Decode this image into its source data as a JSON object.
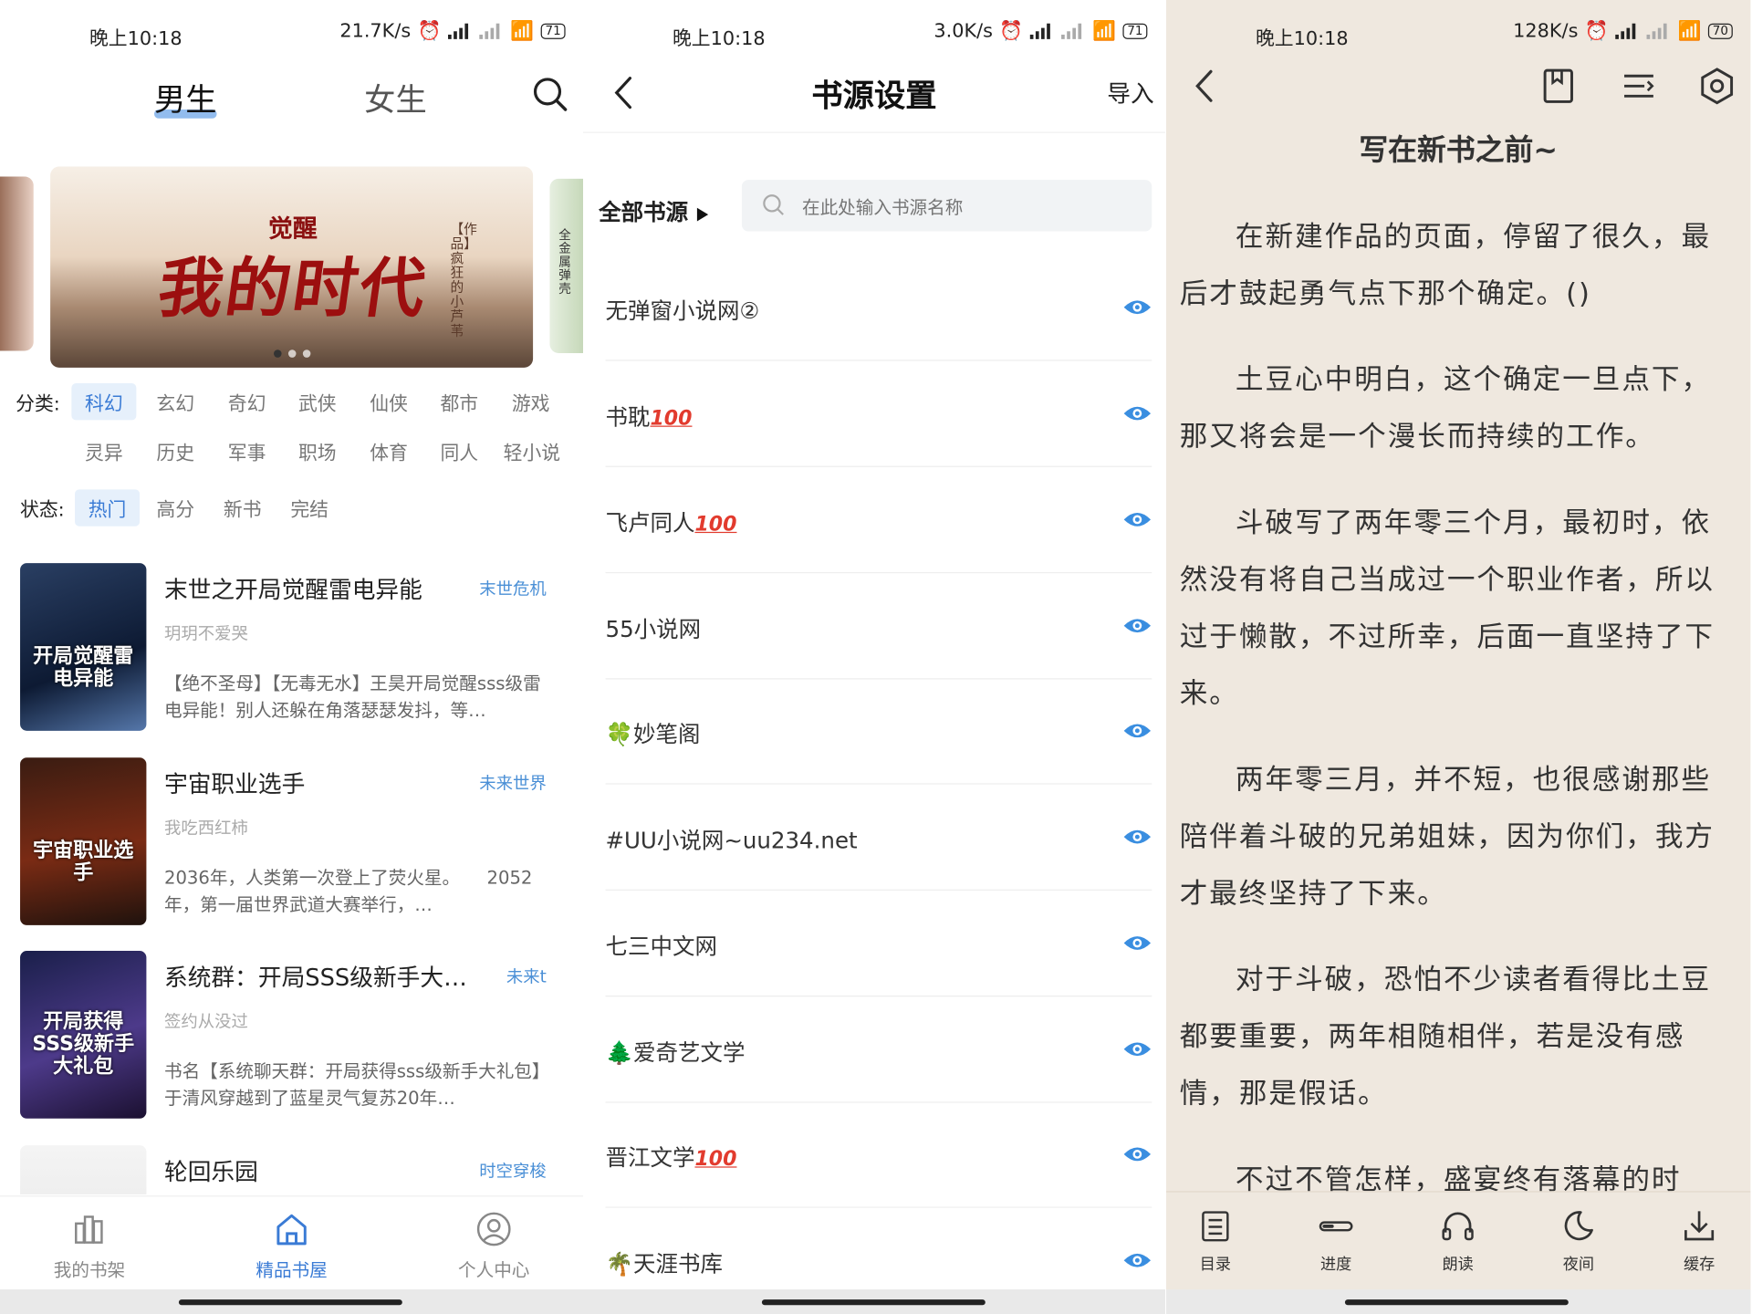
{
  "status_bars": [
    {
      "time": "晚上10:18",
      "speed": "21.7K/s",
      "battery": "71"
    },
    {
      "time": "晚上10:18",
      "speed": "3.0K/s",
      "battery": "71"
    },
    {
      "time": "晚上10:18",
      "speed": "128K/s",
      "battery": "70"
    }
  ],
  "store": {
    "tab_male": "男生",
    "tab_female": "女生",
    "banner": {
      "top_line": "觉醒",
      "main_title": "我的时代",
      "side_text": "【作品】疯狂的小芦苇",
      "right_peek": "全金属弹壳"
    },
    "category_label": "分类:",
    "categories_row1": [
      "科幻",
      "玄幻",
      "奇幻",
      "武侠",
      "仙侠",
      "都市",
      "游戏"
    ],
    "categories_row2": [
      "灵异",
      "历史",
      "军事",
      "职场",
      "体育",
      "同人",
      "轻小说"
    ],
    "status_label": "状态:",
    "statuses": [
      "热门",
      "高分",
      "新书",
      "完结"
    ],
    "books": [
      {
        "title": "末世之开局觉醒雷电异能",
        "tag": "末世危机",
        "author": "玥玥不爱哭",
        "desc": "【绝不圣母】【无毒无水】王昊开局觉醒sss级雷电异能！别人还躲在角落瑟瑟发抖，等…",
        "cover_text": "开局觉醒雷电异能"
      },
      {
        "title": "宇宙职业选手",
        "tag": "未来世界",
        "author": "我吃西红柿",
        "desc": "2036年，人类第一次登上了荧火星。　　2052年，第一届世界武道大赛举行，…",
        "cover_text": "宇宙职业选手"
      },
      {
        "title": "系统群：开局SSS级新手大…",
        "tag": "未来t",
        "author": "签约从没过",
        "desc": "书名【系统聊天群：开局获得sss级新手大礼包】于清风穿越到了蓝星灵气复苏20年…",
        "cover_text": "开局获得SSS级新手大礼包"
      },
      {
        "title": "轮回乐园",
        "tag": "时空穿梭",
        "author": "",
        "desc": "",
        "cover_text": ""
      }
    ],
    "nav": [
      "我的书架",
      "精品书屋",
      "个人中心"
    ]
  },
  "sources": {
    "title": "书源设置",
    "import": "导入",
    "filter": "全部书源",
    "search_placeholder": "在此处输入书源名称",
    "items": [
      {
        "name": "无弹窗小说网②",
        "badge": ""
      },
      {
        "name": "书耽",
        "badge": "100"
      },
      {
        "name": "飞卢同人",
        "badge": "100"
      },
      {
        "name": "55小说网",
        "badge": ""
      },
      {
        "name": "🍀妙笔阁",
        "badge": ""
      },
      {
        "name": "#UU小说网~uu234.net",
        "badge": ""
      },
      {
        "name": "七三中文网",
        "badge": ""
      },
      {
        "name": "🌲爱奇艺文学",
        "badge": ""
      },
      {
        "name": "晋江文学",
        "badge": "100"
      },
      {
        "name": "🌴天涯书库",
        "badge": ""
      }
    ]
  },
  "reader": {
    "chapter_title": "写在新书之前~",
    "paragraphs": [
      "在新建作品的页面，停留了很久，最后才鼓起勇气点下那个确定。()",
      "土豆心中明白，这个确定一旦点下，那又将会是一个漫长而持续的工作。",
      "斗破写了两年零三个月，最初时，依然没有将自己当成过一个职业作者，所以过于懒散，不过所幸，后面一直坚持了下来。",
      "两年零三月，并不短，也很感谢那些陪伴着斗破的兄弟姐妹，因为你们，我方才最终坚持了下来。",
      "对于斗破，恐怕不少读者看得比土豆都要重要，两年相随相伴，若是没有感情，那是假话。",
      "不过不管怎样，盛宴终有落幕的时"
    ],
    "toolbar": [
      "目录",
      "进度",
      "朗读",
      "夜间",
      "缓存"
    ]
  },
  "colors": {
    "accent": "#3a7bd5",
    "reader_bg": "#efe8df",
    "badge_red": "#e23b2e"
  }
}
